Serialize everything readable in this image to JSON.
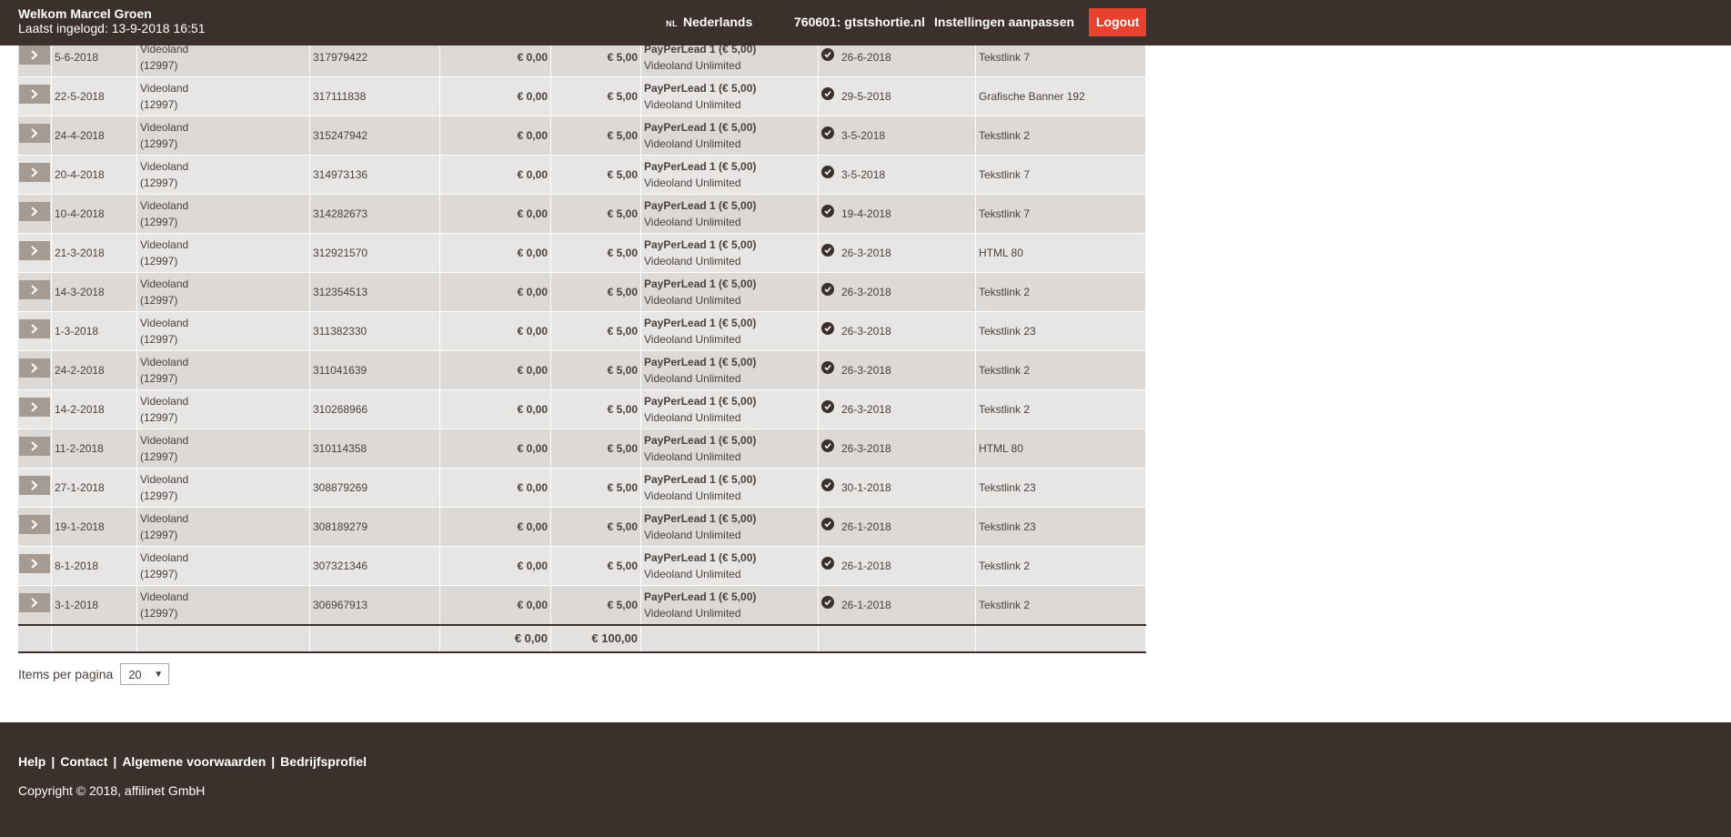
{
  "header": {
    "welcome": "Welkom Marcel Groen",
    "last_login": "Laatst ingelogd: 13-9-2018 16:51",
    "lang_flag": "NL",
    "language": "Nederlands",
    "account": "760601: gtstshortie.nl",
    "settings": "Instellingen aanpassen",
    "logout": "Logout"
  },
  "rows": [
    {
      "date": "5-6-2018",
      "prog1": "Videoland",
      "prog2": "(12997)",
      "id": "317979422",
      "amount": "€ 0,00",
      "commission": "€ 5,00",
      "type": "PayPerLead 1 (€ 5,00)",
      "program": "Videoland Unlimited",
      "status_date": "26-6-2018",
      "media": "Tekstlink 7"
    },
    {
      "date": "22-5-2018",
      "prog1": "Videoland",
      "prog2": "(12997)",
      "id": "317111838",
      "amount": "€ 0,00",
      "commission": "€ 5,00",
      "type": "PayPerLead 1 (€ 5,00)",
      "program": "Videoland Unlimited",
      "status_date": "29-5-2018",
      "media": "Grafische Banner 192"
    },
    {
      "date": "24-4-2018",
      "prog1": "Videoland",
      "prog2": "(12997)",
      "id": "315247942",
      "amount": "€ 0,00",
      "commission": "€ 5,00",
      "type": "PayPerLead 1 (€ 5,00)",
      "program": "Videoland Unlimited",
      "status_date": "3-5-2018",
      "media": "Tekstlink 2"
    },
    {
      "date": "20-4-2018",
      "prog1": "Videoland",
      "prog2": "(12997)",
      "id": "314973136",
      "amount": "€ 0,00",
      "commission": "€ 5,00",
      "type": "PayPerLead 1 (€ 5,00)",
      "program": "Videoland Unlimited",
      "status_date": "3-5-2018",
      "media": "Tekstlink 7"
    },
    {
      "date": "10-4-2018",
      "prog1": "Videoland",
      "prog2": "(12997)",
      "id": "314282673",
      "amount": "€ 0,00",
      "commission": "€ 5,00",
      "type": "PayPerLead 1 (€ 5,00)",
      "program": "Videoland Unlimited",
      "status_date": "19-4-2018",
      "media": "Tekstlink 7"
    },
    {
      "date": "21-3-2018",
      "prog1": "Videoland",
      "prog2": "(12997)",
      "id": "312921570",
      "amount": "€ 0,00",
      "commission": "€ 5,00",
      "type": "PayPerLead 1 (€ 5,00)",
      "program": "Videoland Unlimited",
      "status_date": "26-3-2018",
      "media": "HTML 80"
    },
    {
      "date": "14-3-2018",
      "prog1": "Videoland",
      "prog2": "(12997)",
      "id": "312354513",
      "amount": "€ 0,00",
      "commission": "€ 5,00",
      "type": "PayPerLead 1 (€ 5,00)",
      "program": "Videoland Unlimited",
      "status_date": "26-3-2018",
      "media": "Tekstlink 2"
    },
    {
      "date": "1-3-2018",
      "prog1": "Videoland",
      "prog2": "(12997)",
      "id": "311382330",
      "amount": "€ 0,00",
      "commission": "€ 5,00",
      "type": "PayPerLead 1 (€ 5,00)",
      "program": "Videoland Unlimited",
      "status_date": "26-3-2018",
      "media": "Tekstlink 23"
    },
    {
      "date": "24-2-2018",
      "prog1": "Videoland",
      "prog2": "(12997)",
      "id": "311041639",
      "amount": "€ 0,00",
      "commission": "€ 5,00",
      "type": "PayPerLead 1 (€ 5,00)",
      "program": "Videoland Unlimited",
      "status_date": "26-3-2018",
      "media": "Tekstlink 2"
    },
    {
      "date": "14-2-2018",
      "prog1": "Videoland",
      "prog2": "(12997)",
      "id": "310268966",
      "amount": "€ 0,00",
      "commission": "€ 5,00",
      "type": "PayPerLead 1 (€ 5,00)",
      "program": "Videoland Unlimited",
      "status_date": "26-3-2018",
      "media": "Tekstlink 2"
    },
    {
      "date": "11-2-2018",
      "prog1": "Videoland",
      "prog2": "(12997)",
      "id": "310114358",
      "amount": "€ 0,00",
      "commission": "€ 5,00",
      "type": "PayPerLead 1 (€ 5,00)",
      "program": "Videoland Unlimited",
      "status_date": "26-3-2018",
      "media": "HTML 80"
    },
    {
      "date": "27-1-2018",
      "prog1": "Videoland",
      "prog2": "(12997)",
      "id": "308879269",
      "amount": "€ 0,00",
      "commission": "€ 5,00",
      "type": "PayPerLead 1 (€ 5,00)",
      "program": "Videoland Unlimited",
      "status_date": "30-1-2018",
      "media": "Tekstlink 23"
    },
    {
      "date": "19-1-2018",
      "prog1": "Videoland",
      "prog2": "(12997)",
      "id": "308189279",
      "amount": "€ 0,00",
      "commission": "€ 5,00",
      "type": "PayPerLead 1 (€ 5,00)",
      "program": "Videoland Unlimited",
      "status_date": "26-1-2018",
      "media": "Tekstlink 23"
    },
    {
      "date": "8-1-2018",
      "prog1": "Videoland",
      "prog2": "(12997)",
      "id": "307321346",
      "amount": "€ 0,00",
      "commission": "€ 5,00",
      "type": "PayPerLead 1 (€ 5,00)",
      "program": "Videoland Unlimited",
      "status_date": "26-1-2018",
      "media": "Tekstlink 2"
    },
    {
      "date": "3-1-2018",
      "prog1": "Videoland",
      "prog2": "(12997)",
      "id": "306967913",
      "amount": "€ 0,00",
      "commission": "€ 5,00",
      "type": "PayPerLead 1 (€ 5,00)",
      "program": "Videoland Unlimited",
      "status_date": "26-1-2018",
      "media": "Tekstlink 2"
    }
  ],
  "totals": {
    "amount": "€ 0,00",
    "commission": "€ 100,00"
  },
  "pagination": {
    "label": "Items per pagina",
    "value": "20"
  },
  "footer": {
    "links": [
      "Help",
      "Contact",
      "Algemene voorwaarden",
      "Bedrijfsprofiel"
    ],
    "copyright": "Copyright © 2018, affilinet GmbH"
  },
  "icons": {
    "row_expand": "chevron-right-icon",
    "status": "check-circle-icon",
    "select_caret": "caret-down-icon"
  },
  "colors": {
    "header_bg": "#3b302b",
    "logout": "#e8412f",
    "row_odd": "#e8e6e4",
    "row_even": "#dcd9d6",
    "arrow_button": "#a59b93"
  }
}
